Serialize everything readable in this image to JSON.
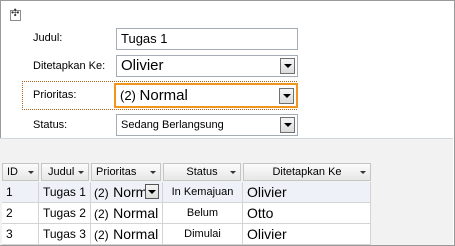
{
  "form": {
    "judul_label": "Judul:",
    "judul_value": "Tugas 1",
    "assigned_label": "Ditetapkan Ke:",
    "assigned_value": "Olivier",
    "priority_label": "Prioritas:",
    "priority_prefix": "(2)",
    "priority_value": "Normal",
    "status_label": "Status:",
    "status_value": "Sedang Berlangsung"
  },
  "table": {
    "headers": {
      "id": "ID",
      "judul": "Judul",
      "prioritas": "Prioritas",
      "status": "Status",
      "assigned": "Ditetapkan Ke"
    },
    "rows": [
      {
        "id": "1",
        "judul": "Tugas 1",
        "pri_prefix": "(2)",
        "pri_value": "Norm",
        "status": "In Kemajuan",
        "assigned": "Olivier"
      },
      {
        "id": "2",
        "judul": "Tugas 2",
        "pri_prefix": "(2)",
        "pri_value": "Normal",
        "status": "Belum",
        "assigned": "Otto"
      },
      {
        "id": "3",
        "judul": "Tugas 3",
        "pri_prefix": "(2)",
        "pri_value": "Normal",
        "status": "Dimulai",
        "assigned": "Olivier"
      }
    ]
  },
  "colors": {
    "focus_highlight": "#f0961e",
    "focus_dotted": "#b0651a"
  }
}
